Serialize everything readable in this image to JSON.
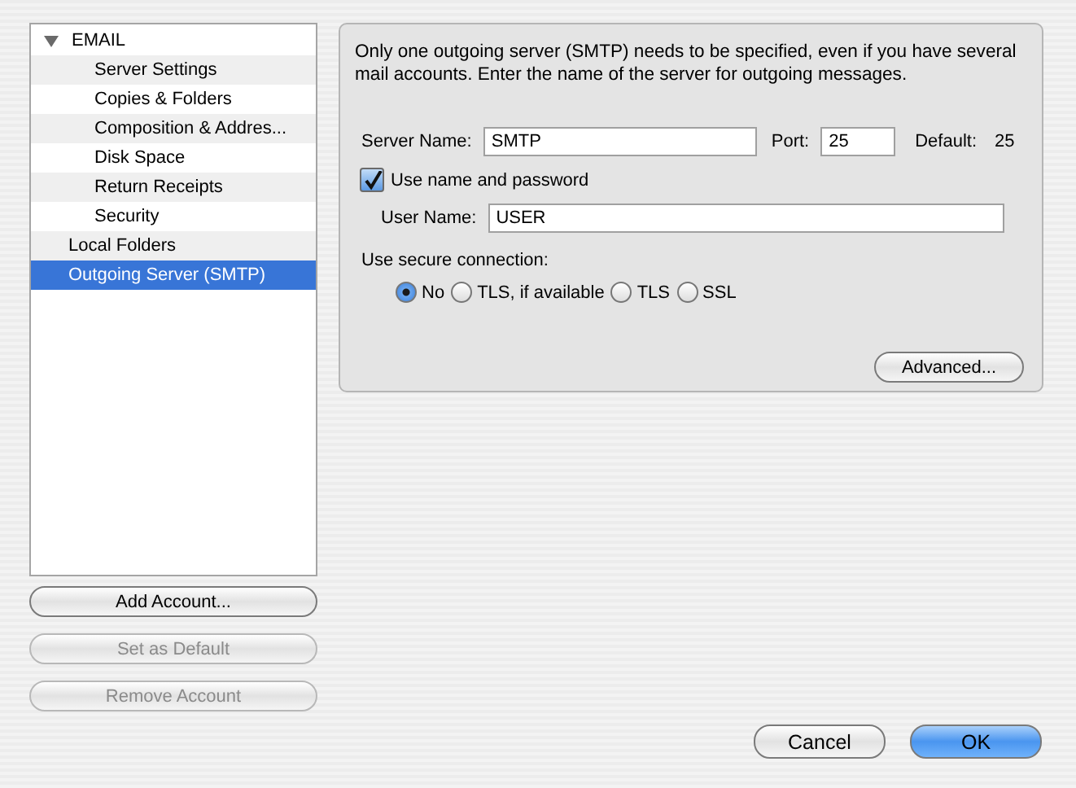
{
  "sidebar": {
    "items": [
      {
        "label": "EMAIL",
        "expanded": true,
        "selected": false,
        "children": [
          {
            "label": "Server Settings",
            "selected": false
          },
          {
            "label": "Copies & Folders",
            "selected": false
          },
          {
            "label": "Composition & Addres...",
            "selected": false
          },
          {
            "label": "Disk Space",
            "selected": false
          },
          {
            "label": "Return Receipts",
            "selected": false
          },
          {
            "label": "Security",
            "selected": false
          }
        ]
      },
      {
        "label": "Local Folders",
        "selected": false
      },
      {
        "label": "Outgoing Server (SMTP)",
        "selected": true
      }
    ],
    "buttons": [
      {
        "label": "Add Account...",
        "disabled": false
      },
      {
        "label": "Set as Default",
        "disabled": true
      },
      {
        "label": "Remove Account",
        "disabled": true
      }
    ]
  },
  "panel": {
    "description": "Only one outgoing server (SMTP) needs to be specified, even if you have several mail accounts. Enter the name of the server for outgoing messages.",
    "server_name": {
      "label": "Server Name:",
      "value": "SMTP"
    },
    "port": {
      "label": "Port:",
      "value": "25"
    },
    "default": {
      "label": "Default:",
      "value": "25"
    },
    "use_name_password": {
      "label": "Use name and password",
      "checked": true
    },
    "user_name": {
      "label": "User Name:",
      "value": "USER"
    },
    "secure_label": "Use secure connection:",
    "secure_options": [
      {
        "label": "No",
        "selected": true
      },
      {
        "label": "TLS, if available",
        "selected": false
      },
      {
        "label": "TLS",
        "selected": false
      },
      {
        "label": "SSL",
        "selected": false
      }
    ],
    "advanced_button": "Advanced..."
  },
  "dialog_buttons": [
    {
      "label": "Cancel",
      "kind": "normal"
    },
    {
      "label": "OK",
      "kind": "default"
    }
  ]
}
